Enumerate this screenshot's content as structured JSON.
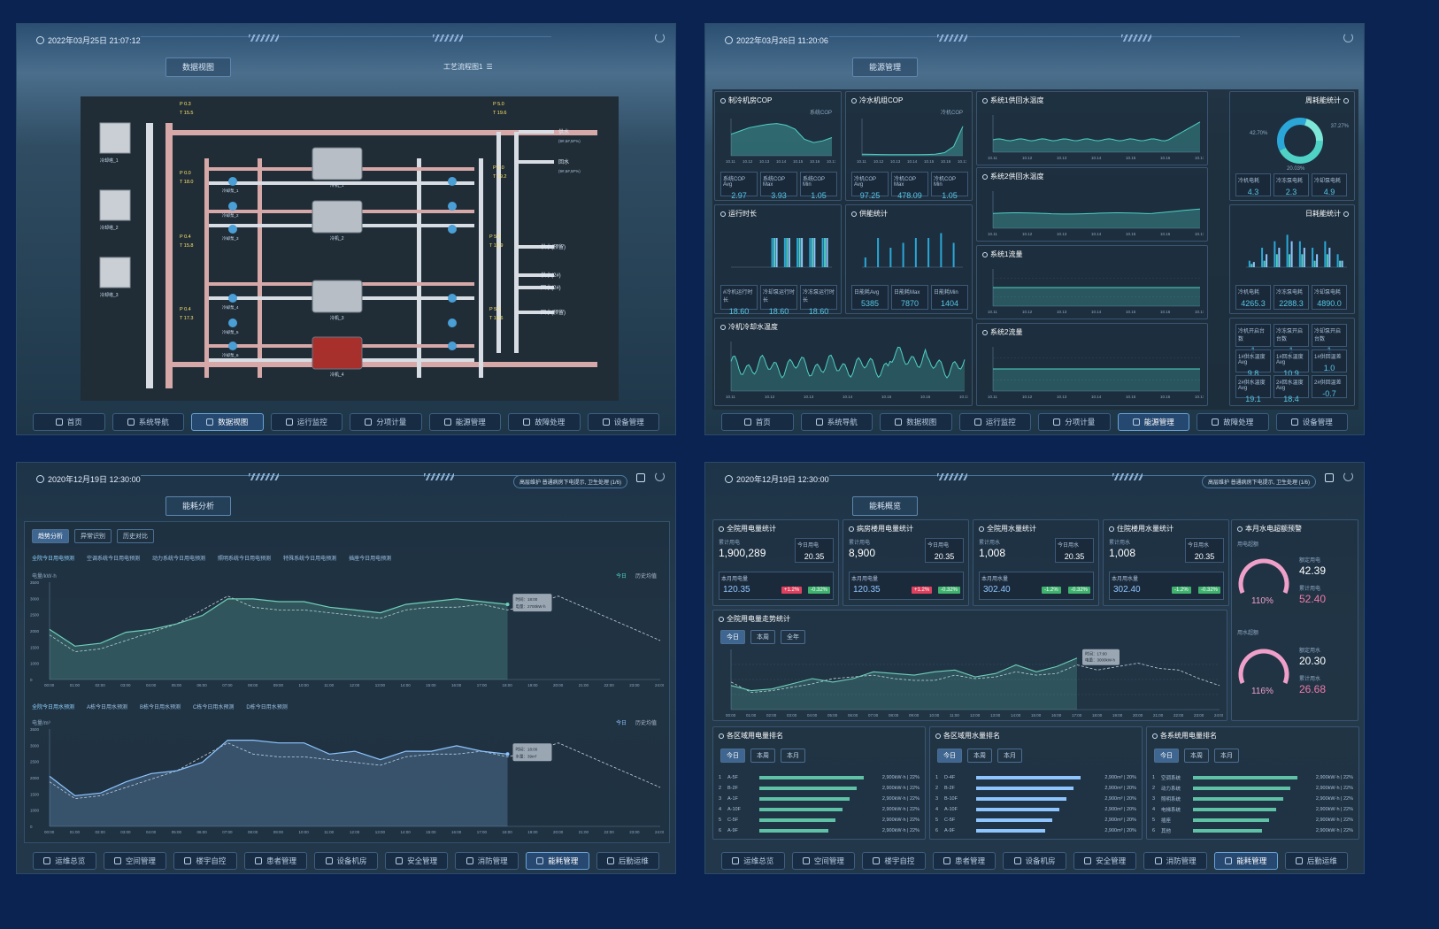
{
  "p1": {
    "datetime": "2022年03月25日 21:07:12",
    "tab": "数据视图",
    "flow_btn": "工艺流程图1",
    "pumps": [
      "冷却泵_1",
      "冷却泵_2",
      "冷却泵_3",
      "冷却泵_4",
      "冷却泵_5",
      "冷却泵_6"
    ],
    "chillers": [
      "冷机_1",
      "冷机_2",
      "冷机_3",
      "冷机_4"
    ],
    "towers": [
      "冷却塔_1",
      "冷却塔_2",
      "冷却塔_3"
    ],
    "pipes": [
      "供水",
      "回水",
      "供水(预留)",
      "供水(2#)",
      "回水(2#)",
      "回水(预留)"
    ],
    "pressure": [
      "P 0.3",
      "T 15.5",
      "P 0.0",
      "T 18.0",
      "P 0.4",
      "T 15.8",
      "P 0.4",
      "T 17.3",
      "P 5.0",
      "T 19.6",
      "P 5.0",
      "T 19.2",
      "P 5.0",
      "T 18.9",
      "P 5.0",
      "T 18.6"
    ],
    "pipe_note": "(9#,6#,5F%)",
    "nav": [
      "首页",
      "系统导航",
      "数据视图",
      "运行监控",
      "分项计量",
      "能源管理",
      "故障处理",
      "设备管理"
    ],
    "nav_active": 2
  },
  "p2": {
    "datetime": "2022年03月26日 11:20:06",
    "tab": "能源管理",
    "cards": {
      "cop_title": "制冷机房COP",
      "cop_legend": "系统COP",
      "chiller_cop_title": "冷水机组COP",
      "chiller_cop_legend": "冷机COP",
      "supply_temp1": "系统1供回水温度",
      "supply_temp2": "系统2供回水温度",
      "flow1": "系统1流量",
      "flow2": "系统2流量",
      "runtime": "运行时长",
      "power": "供能统计",
      "cooling_temp": "冷机冷却水温度",
      "monthly": "周耗能统计",
      "daily": "日耗能统计"
    },
    "cop_stats": [
      {
        "label": "系统COP Avg",
        "value": "2.97"
      },
      {
        "label": "系统COP Max",
        "value": "3.93"
      },
      {
        "label": "系统COP Min",
        "value": "1.05"
      }
    ],
    "chiller_stats": [
      {
        "label": "冷机COP Avg",
        "value": "97.25"
      },
      {
        "label": "冷机COP Max",
        "value": "478.09"
      },
      {
        "label": "冷机COP Min",
        "value": "1.05"
      }
    ],
    "runtime_stats": [
      {
        "label": "#冷机运行时长",
        "value": "18.60"
      },
      {
        "label": "冷却泵运行时长",
        "value": "18.60"
      },
      {
        "label": "冷冻泵运行时长",
        "value": "18.60"
      }
    ],
    "power_stats": [
      {
        "label": "日能耗Avg",
        "value": "5385"
      },
      {
        "label": "日能耗Max",
        "value": "7870"
      },
      {
        "label": "日能耗Min",
        "value": "1404"
      }
    ],
    "energy_stats": [
      {
        "label": "冷机电耗",
        "value": "4.3"
      },
      {
        "label": "冷冻泵电耗",
        "value": "2.3"
      },
      {
        "label": "冷却泵电耗",
        "value": "4.9"
      }
    ],
    "daily_stats": [
      {
        "label": "冷机电耗",
        "value": "4265.3"
      },
      {
        "label": "冷冻泵电耗",
        "value": "2288.3"
      },
      {
        "label": "冷却泵电耗",
        "value": "4890.0"
      }
    ],
    "bottom_stats": [
      {
        "label": "冷机开启台数",
        "value": "1"
      },
      {
        "label": "冷冻泵开启台数",
        "value": "1"
      },
      {
        "label": "冷却泵开启台数",
        "value": "1"
      },
      {
        "label": "1#供水温度Avg",
        "value": "9.8"
      },
      {
        "label": "1#回水温度Avg",
        "value": "10.9"
      },
      {
        "label": "1#供回温差",
        "value": "1.0"
      },
      {
        "label": "2#供水温度Avg",
        "value": "19.1"
      },
      {
        "label": "2#回水温度Avg",
        "value": "18.4"
      },
      {
        "label": "2#供回温差",
        "value": "-0.7"
      }
    ],
    "donut_labels": [
      "42.70%",
      "37.27%",
      "20.03%"
    ],
    "xdates": [
      "10.11",
      "10.12",
      "10.13",
      "10.14",
      "10.15",
      "10.16",
      "10.17"
    ],
    "nav": [
      "首页",
      "系统导航",
      "数据视图",
      "运行监控",
      "分项计量",
      "能源管理",
      "故障处理",
      "设备管理"
    ],
    "nav_active": 5
  },
  "p3": {
    "datetime": "2020年12月19日 12:30:00",
    "tab": "能耗分析",
    "alert": "高层维护 普通病房下电提示, 卫生处理 (1/6)",
    "subtabs": [
      "趋势分析",
      "异常识别",
      "历史对比"
    ],
    "section1": "全院今日用电预测",
    "section1_tabs": [
      "空调系统今日用电预测",
      "动力系统今日用电预测",
      "照明系统今日用电预测",
      "特殊系统今日用电预测",
      "插座今日用电预测"
    ],
    "section2": "全院今日用水预测",
    "section2_tabs": [
      "A栋今日用水预测",
      "B栋今日用水预测",
      "C栋今日用水预测",
      "D栋今日用水预测"
    ],
    "legend": [
      "今日",
      "历史均值"
    ],
    "tooltip1": [
      "时间：18:00",
      "电量：2700kW·h"
    ],
    "tooltip2": [
      "时间：18:00",
      "水量：39m³"
    ],
    "unit1": "电量/kW·h",
    "unit2": "电量/m³",
    "yticks": [
      "3500",
      "3000",
      "2500",
      "2000",
      "1500",
      "1000",
      "0"
    ],
    "hours": [
      "00:00",
      "01:00",
      "02:00",
      "03:00",
      "04:00",
      "05:00",
      "06:00",
      "07:00",
      "08:00",
      "09:00",
      "10:00",
      "11:00",
      "12:00",
      "13:00",
      "14:00",
      "15:00",
      "16:00",
      "17:00",
      "18:00",
      "19:00",
      "20:00",
      "21:00",
      "22:00",
      "23:00",
      "24:00"
    ],
    "nav": [
      "运维总览",
      "空间管理",
      "楼宇自控",
      "患者管理",
      "设备机房",
      "安全管理",
      "消防管理",
      "能耗管理",
      "后勤运维"
    ],
    "nav_active": 7
  },
  "p4": {
    "datetime": "2020年12月19日 12:30:00",
    "tab": "能耗概览",
    "alert": "高层维护 普通病房下电提示, 卫生处理 (1/6)",
    "stats": [
      {
        "title": "全院用电量统计",
        "acc_label": "累计用电",
        "acc": "1,900,289",
        "today_label": "今日用电",
        "today": "20.35",
        "month_label": "本月用电量",
        "month": "120.35",
        "yoy": "+1.2%",
        "mom": "-0.32%"
      },
      {
        "title": "病房楼用电量统计",
        "acc_label": "累计用电",
        "acc": "8,900",
        "today_label": "今日用电",
        "today": "20.35",
        "month_label": "本月用电量",
        "month": "120.35",
        "yoy": "+1.2%",
        "mom": "-0.32%"
      },
      {
        "title": "全院用水量统计",
        "acc_label": "累计用水",
        "acc": "1,008",
        "today_label": "今日用水",
        "today": "20.35",
        "month_label": "本月用水量",
        "month": "302.40",
        "yoy": "-1.2%",
        "mom": "-0.32%"
      },
      {
        "title": "住院楼用水量统计",
        "acc_label": "累计用水",
        "acc": "1,008",
        "today_label": "今日用水",
        "today": "20.35",
        "month_label": "本月用水量",
        "month": "302.40",
        "yoy": "-1.2%",
        "mom": "-0.32%"
      }
    ],
    "warn_title": "本月水电超额预警",
    "elec_label": "用电超额",
    "water_label": "用水超额",
    "gauge1": {
      "pct": "110%",
      "limit_label": "额定用电",
      "limit": "42.39",
      "used_label": "累计用电",
      "used": "52.40"
    },
    "gauge2": {
      "pct": "116%",
      "limit_label": "额定用水",
      "limit": "20.30",
      "used_label": "累计用水",
      "used": "26.68"
    },
    "trend_title": "全院用电量走势统计",
    "trend_tabs": [
      "今日",
      "本周",
      "全年"
    ],
    "tooltip": [
      "时间：17:00",
      "电量：3000kW·h"
    ],
    "rank_titles": [
      "各区域用电量排名",
      "各区域用水量排名",
      "各系统用电量排名"
    ],
    "rank_tabs": [
      "今日",
      "本周",
      "本月"
    ],
    "rank_elec": [
      {
        "rank": "1",
        "name": "A-5F",
        "value": "2,900kW·h | 22%"
      },
      {
        "rank": "2",
        "name": "B-2F",
        "value": "2,900kW·h | 22%"
      },
      {
        "rank": "3",
        "name": "A-1F",
        "value": "2,900kW·h | 22%"
      },
      {
        "rank": "4",
        "name": "A-10F",
        "value": "2,900kW·h | 22%"
      },
      {
        "rank": "5",
        "name": "C-5F",
        "value": "2,900kW·h | 22%"
      },
      {
        "rank": "6",
        "name": "A-9F",
        "value": "2,900kW·h | 22%"
      }
    ],
    "rank_water": [
      {
        "rank": "1",
        "name": "D-4F",
        "value": "2,900m³ | 20%"
      },
      {
        "rank": "2",
        "name": "B-2F",
        "value": "2,900m³ | 20%"
      },
      {
        "rank": "3",
        "name": "B-10F",
        "value": "2,900m³ | 20%"
      },
      {
        "rank": "4",
        "name": "A-10F",
        "value": "2,900m³ | 20%"
      },
      {
        "rank": "5",
        "name": "C-5F",
        "value": "2,900m³ | 20%"
      },
      {
        "rank": "6",
        "name": "A-9F",
        "value": "2,900m³ | 20%"
      }
    ],
    "rank_sys": [
      {
        "rank": "1",
        "name": "空调系统",
        "value": "2,900kW·h | 22%"
      },
      {
        "rank": "2",
        "name": "动力系统",
        "value": "2,900kW·h | 22%"
      },
      {
        "rank": "3",
        "name": "照明系统",
        "value": "2,900kW·h | 22%"
      },
      {
        "rank": "4",
        "name": "电梯系统",
        "value": "2,900kW·h | 22%"
      },
      {
        "rank": "5",
        "name": "插座",
        "value": "2,900kW·h | 22%"
      },
      {
        "rank": "6",
        "name": "其他",
        "value": "2,900kW·h | 22%"
      }
    ],
    "nav": [
      "运维总览",
      "空间管理",
      "楼宇自控",
      "患者管理",
      "设备机房",
      "安全管理",
      "消防管理",
      "能耗管理",
      "后勤运维"
    ],
    "nav_active": 7
  },
  "colors": {
    "accent": "#4fd1c5",
    "elec": "#57c7e6",
    "bar": "#5fc2a6",
    "water": "#8ec5ff",
    "red": "#e0405e",
    "green": "#3fb36e"
  }
}
